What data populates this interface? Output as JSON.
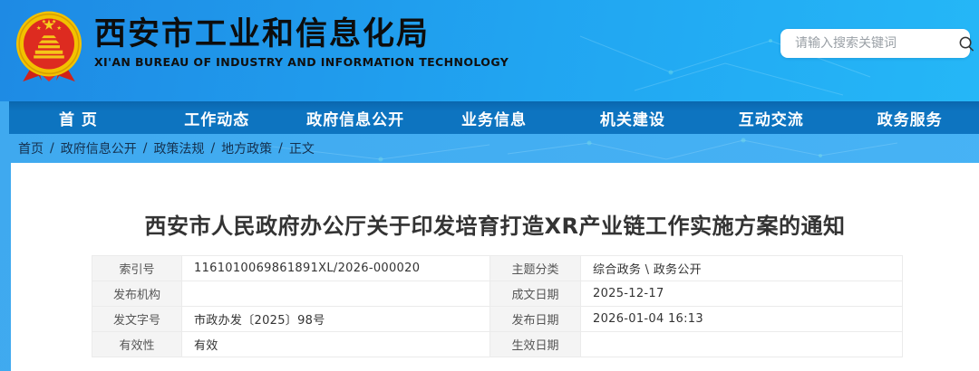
{
  "header": {
    "org_name": "西安市工业和信息化局",
    "org_name_en": "XI'AN BUREAU OF INDUSTRY AND INFORMATION TECHNOLOGY",
    "search": {
      "placeholder": "请输入搜索关键词"
    }
  },
  "nav": {
    "items": [
      "首 页",
      "工作动态",
      "政府信息公开",
      "业务信息",
      "机关建设",
      "互动交流",
      "政务服务"
    ]
  },
  "breadcrumb": {
    "separator": "/",
    "items": [
      "首页",
      "政府信息公开",
      "政策法规",
      "地方政策",
      "正文"
    ]
  },
  "article": {
    "title": "西安市人民政府办公厅关于印发培育打造XR产业链工作实施方案的通知"
  },
  "meta_table": {
    "rows": [
      [
        {
          "label": "索引号",
          "value": "1161010069861891XL/2026-000020"
        },
        {
          "label": "主题分类",
          "value": "综合政务 \\ 政务公开"
        }
      ],
      [
        {
          "label": "发布机构",
          "value": ""
        },
        {
          "label": "成文日期",
          "value": "2025-12-17"
        }
      ],
      [
        {
          "label": "发文字号",
          "value": "市政办发〔2025〕98号"
        },
        {
          "label": "发布日期",
          "value": "2026-01-04 16:13"
        }
      ],
      [
        {
          "label": "有效性",
          "value": "有效"
        },
        {
          "label": "生效日期",
          "value": ""
        }
      ]
    ]
  },
  "icons": {
    "emblem": "national-emblem-icon",
    "search": "search-icon"
  },
  "colors": {
    "header_gradient_start": "#1e8ae4",
    "header_gradient_end": "#25b7f7",
    "nav_blue": "#0d74c0",
    "breadcrumb_bg": "#45b0f3",
    "panel_bg": "#ffffff",
    "label_cell_bg": "#f4f4f4",
    "emblem_red": "#dd2b20",
    "emblem_gold": "#f5c400"
  }
}
